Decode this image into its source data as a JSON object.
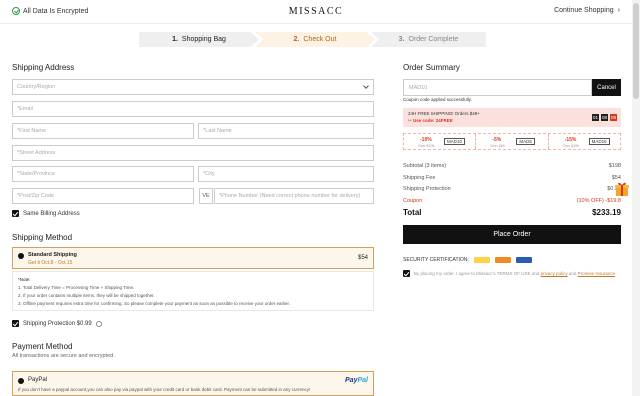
{
  "header": {
    "encrypted": "All Data Is Encrypted",
    "logo": "MISSACC",
    "continue": "Continue Shopping",
    "continue_chevron": "›"
  },
  "steps": [
    {
      "num": "1.",
      "label": "Shopping Bag"
    },
    {
      "num": "2.",
      "label": "Check Out"
    },
    {
      "num": "3.",
      "label": "Order Complete"
    }
  ],
  "shipping_address": {
    "title": "Shipping Address",
    "country": "Country/Region",
    "email": "*Email",
    "first_name": "*First Name",
    "last_name": "*Last Name",
    "street": "*Street Address",
    "state": "*State/Province",
    "city": "*City",
    "zip": "*Post/Zip Code",
    "phone_prefix": "VE",
    "phone": "*Phone Number (Need correct phone number for delivery)",
    "same_billing": "Same Billing Address"
  },
  "shipping_method": {
    "title": "Shipping Method",
    "option": "Standard Shipping",
    "eta": "Get it Oct.8 - Oct.15",
    "price": "$54",
    "note_title": "*Note:",
    "notes": [
      "1. Total Delivery Time = Processing Time + Shipping Time.",
      "2. If your order contains multiple items, they will be shipped together.",
      "3. Offline payment requires extra time for confirming. So please complete your payment as soon as possible to receive your order earlier."
    ],
    "protection": "Shipping Protection $0.99"
  },
  "payment": {
    "title": "Payment Method",
    "subtitle": "All transactions are secure and encrypted.",
    "option": "PayPal",
    "desc": "If you don't have a paypal account,you can also pay via paypal with your credit card or bank debit card. Payment can be submitted in any currency!",
    "logo_a": "Pay",
    "logo_b": "Pal"
  },
  "summary": {
    "title": "Order Summary",
    "coupon_value": "MAD10",
    "cancel": "Cancel",
    "applied": "Coupon code applied successfully.",
    "promo_line1": "24H FREE SHIPPING! Orders $49+",
    "promo_line2": "Use code: 24FREE",
    "timer": [
      "01",
      "08",
      "09"
    ],
    "coupons": [
      {
        "pct": "-10%",
        "over": "Over $109",
        "code": "MAD10"
      },
      {
        "pct": "-5%",
        "over": "Over $69",
        "code": "MAD5"
      },
      {
        "pct": "-15%",
        "over": "Over $159",
        "code": "MAD15"
      }
    ],
    "rows": [
      {
        "k": "Subtotal (3 items)",
        "v": "$198"
      },
      {
        "k": "Shipping Fee",
        "v": "$54"
      },
      {
        "k": "Shipping Protection",
        "v": "$0.99"
      },
      {
        "k": "Coupon",
        "v": "(10% OFF) -$19.8"
      }
    ],
    "total_label": "Total",
    "total_value": "$233.19",
    "place_order": "Place Order",
    "security": "SECURITY CERTIFICATION:",
    "agree_pre": "By placing my order, I agree to Missacc's TERMS OF USE and",
    "agree_link1": "privacy policy",
    "agree_mid": "and",
    "agree_link2": "Promise Insurance",
    "colors": {
      "accent": "#d4a15a",
      "red": "#d23a1e",
      "dark": "#111111"
    }
  }
}
